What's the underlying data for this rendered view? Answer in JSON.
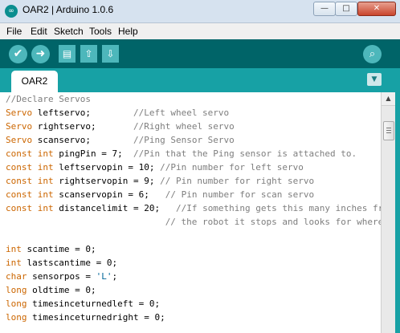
{
  "window": {
    "title": "OAR2 | Arduino 1.0.6",
    "app_icon": "∞",
    "minimize_icon": "—",
    "maximize_icon": "□",
    "close_icon": "✕"
  },
  "menu": {
    "items": [
      "File",
      "Edit",
      "Sketch",
      "Tools",
      "Help"
    ]
  },
  "toolbar": {
    "verify_icon": "✔",
    "upload_icon": "➜",
    "new_icon": "▤",
    "open_icon": "⇧",
    "save_icon": "⇩",
    "serial_monitor_icon": "⌕"
  },
  "tabs": {
    "active": "OAR2",
    "menu_icon": "▼"
  },
  "scrollbar": {
    "up_icon": "▲"
  },
  "colors": {
    "toolbar_bg": "#006468",
    "tabbar_bg": "#17a1a5",
    "button_bg": "#4db7bb",
    "keyword": "#cc6600",
    "comment": "#7e7e7e",
    "string": "#006699"
  },
  "code": {
    "lines": [
      [
        {
          "t": "//Declare Servos",
          "c": "cm"
        }
      ],
      [
        {
          "t": "Servo",
          "c": "kw"
        },
        {
          "t": " leftservo;        "
        },
        {
          "t": "//Left wheel servo",
          "c": "cm"
        }
      ],
      [
        {
          "t": "Servo",
          "c": "kw"
        },
        {
          "t": " rightservo;       "
        },
        {
          "t": "//Right wheel servo",
          "c": "cm"
        }
      ],
      [
        {
          "t": "Servo",
          "c": "kw"
        },
        {
          "t": " scanservo;        "
        },
        {
          "t": "//Ping Sensor Servo",
          "c": "cm"
        }
      ],
      [
        {
          "t": "const",
          "c": "kw"
        },
        {
          "t": " "
        },
        {
          "t": "int",
          "c": "kw"
        },
        {
          "t": " pingPin = 7;  "
        },
        {
          "t": "//Pin that the Ping sensor is attached to.",
          "c": "cm"
        }
      ],
      [
        {
          "t": "const",
          "c": "kw"
        },
        {
          "t": " "
        },
        {
          "t": "int",
          "c": "kw"
        },
        {
          "t": " leftservopin = 10; "
        },
        {
          "t": "//Pin number for left servo",
          "c": "cm"
        }
      ],
      [
        {
          "t": "const",
          "c": "kw"
        },
        {
          "t": " "
        },
        {
          "t": "int",
          "c": "kw"
        },
        {
          "t": " rightservopin = 9; "
        },
        {
          "t": "// Pin number for right servo",
          "c": "cm"
        }
      ],
      [
        {
          "t": "const",
          "c": "kw"
        },
        {
          "t": " "
        },
        {
          "t": "int",
          "c": "kw"
        },
        {
          "t": " scanservopin = 6;   "
        },
        {
          "t": "// Pin number for scan servo",
          "c": "cm"
        }
      ],
      [
        {
          "t": "const",
          "c": "kw"
        },
        {
          "t": " "
        },
        {
          "t": "int",
          "c": "kw"
        },
        {
          "t": " distancelimit = 20;   "
        },
        {
          "t": "//If something gets this many inches from",
          "c": "cm"
        }
      ],
      [
        {
          "t": "                              "
        },
        {
          "t": "// the robot it stops and looks for where",
          "c": "cm"
        }
      ],
      [
        {
          "t": ""
        }
      ],
      [
        {
          "t": "int",
          "c": "kw"
        },
        {
          "t": " scantime = 0;"
        }
      ],
      [
        {
          "t": "int",
          "c": "kw"
        },
        {
          "t": " lastscantime = 0;"
        }
      ],
      [
        {
          "t": "char",
          "c": "kw"
        },
        {
          "t": " sensorpos = "
        },
        {
          "t": "'L'",
          "c": "st"
        },
        {
          "t": ";"
        }
      ],
      [
        {
          "t": "long",
          "c": "kw"
        },
        {
          "t": " oldtime = 0;"
        }
      ],
      [
        {
          "t": "long",
          "c": "kw"
        },
        {
          "t": " timesinceturnedleft = 0;"
        }
      ],
      [
        {
          "t": "long",
          "c": "kw"
        },
        {
          "t": " timesinceturnedright = 0;"
        }
      ]
    ]
  }
}
